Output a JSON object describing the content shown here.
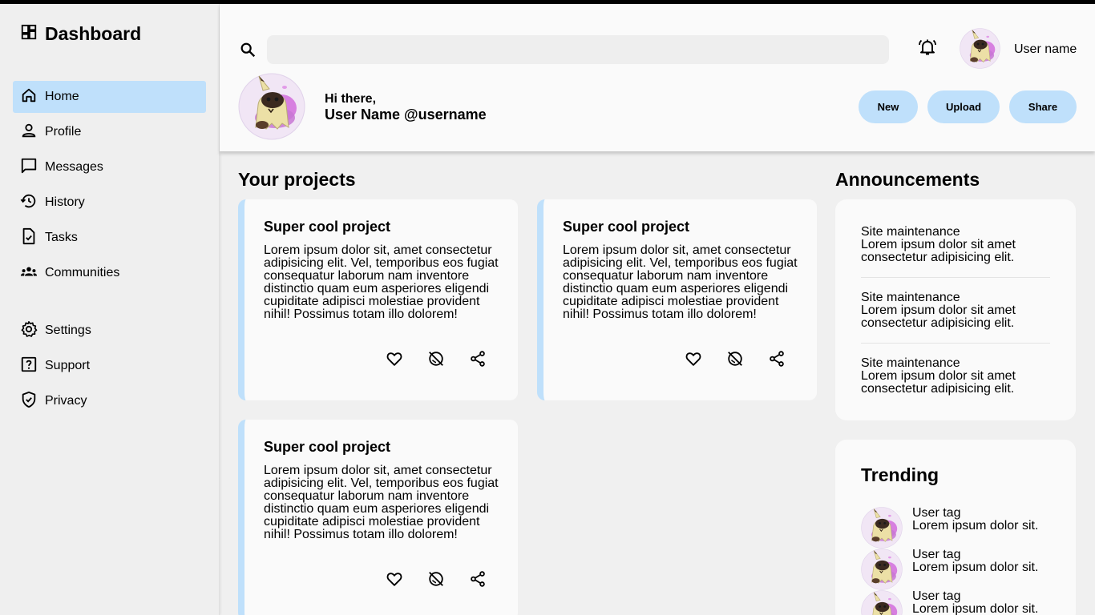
{
  "brand": {
    "title": "Dashboard"
  },
  "sidebar": {
    "main_items": [
      {
        "label": "Home",
        "icon": "home-icon",
        "active": true
      },
      {
        "label": "Profile",
        "icon": "person-icon"
      },
      {
        "label": "Messages",
        "icon": "message-icon"
      },
      {
        "label": "History",
        "icon": "history-icon"
      },
      {
        "label": "Tasks",
        "icon": "task-icon"
      },
      {
        "label": "Communities",
        "icon": "groups-icon"
      }
    ],
    "secondary_items": [
      {
        "label": "Settings",
        "icon": "gear-icon"
      },
      {
        "label": "Support",
        "icon": "help-icon"
      },
      {
        "label": "Privacy",
        "icon": "shield-icon"
      }
    ]
  },
  "header": {
    "search_value": "",
    "user_name": "User name",
    "greeting": "Hi there,",
    "user_display": "User Name @username",
    "actions": {
      "new": "New",
      "upload": "Upload",
      "share": "Share"
    }
  },
  "projects": {
    "title": "Your projects",
    "cards": [
      {
        "title": "Super cool project",
        "body": "Lorem ipsum dolor sit, amet consectetur adipisicing elit. Vel, temporibus eos fugiat consequatur laborum nam inventore distinctio quam eum asperiores eligendi cupiditate adipisci molestiae provident nihil! Possimus totam illo dolorem!"
      },
      {
        "title": "Super cool project",
        "body": "Lorem ipsum dolor sit, amet consectetur adipisicing elit. Vel, temporibus eos fugiat consequatur laborum nam inventore distinctio quam eum asperiores eligendi cupiditate adipisci molestiae provident nihil! Possimus totam illo dolorem!"
      },
      {
        "title": "Super cool project",
        "body": "Lorem ipsum dolor sit, amet consectetur adipisicing elit. Vel, temporibus eos fugiat consequatur laborum nam inventore distinctio quam eum asperiores eligendi cupiditate adipisci molestiae provident nihil! Possimus totam illo dolorem!"
      }
    ]
  },
  "announcements": {
    "title": "Announcements",
    "items": [
      {
        "title": "Site maintenance",
        "body": "Lorem ipsum dolor sit amet consectetur adipisicing elit."
      },
      {
        "title": "Site maintenance",
        "body": "Lorem ipsum dolor sit amet consectetur adipisicing elit."
      },
      {
        "title": "Site maintenance",
        "body": "Lorem ipsum dolor sit amet consectetur adipisicing elit."
      }
    ]
  },
  "trending": {
    "title": "Trending",
    "items": [
      {
        "tag": "User tag",
        "text": "Lorem ipsum dolor sit."
      },
      {
        "tag": "User tag",
        "text": "Lorem ipsum dolor sit."
      },
      {
        "tag": "User tag",
        "text": "Lorem ipsum dolor sit."
      }
    ]
  },
  "colors": {
    "accent": "#bfe0fb",
    "sidebar_bg": "#efefef",
    "panel_bg": "#fafafa",
    "page_bg": "#f0f0f0"
  }
}
